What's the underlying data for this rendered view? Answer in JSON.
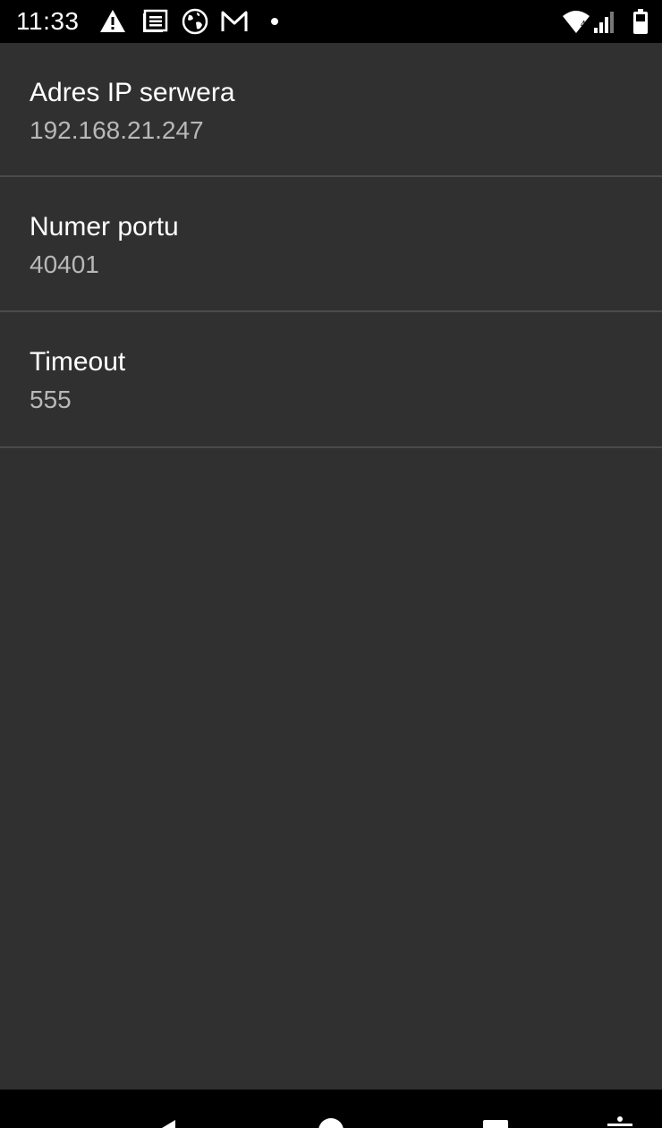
{
  "status_bar": {
    "time": "11:33",
    "left_icons": [
      "warning-icon",
      "message-icon",
      "globe-icon",
      "gmail-icon",
      "dot-icon"
    ],
    "right_icons": [
      "wifi-icon",
      "signal-icon",
      "battery-icon"
    ],
    "wifi_label": "4"
  },
  "settings": {
    "items": [
      {
        "title": "Adres IP serwera",
        "summary": "192.168.21.247"
      },
      {
        "title": "Numer portu",
        "summary": "40401"
      },
      {
        "title": "Timeout",
        "summary": "555"
      }
    ]
  },
  "nav_bar": {
    "icons": [
      "back-icon",
      "home-icon",
      "recents-icon",
      "accessibility-icon"
    ]
  },
  "colors": {
    "background": "#303030",
    "status_bar": "#000000",
    "divider": "#4a4a4a",
    "title_text": "#ffffff",
    "summary_text": "#b8b8b8"
  }
}
